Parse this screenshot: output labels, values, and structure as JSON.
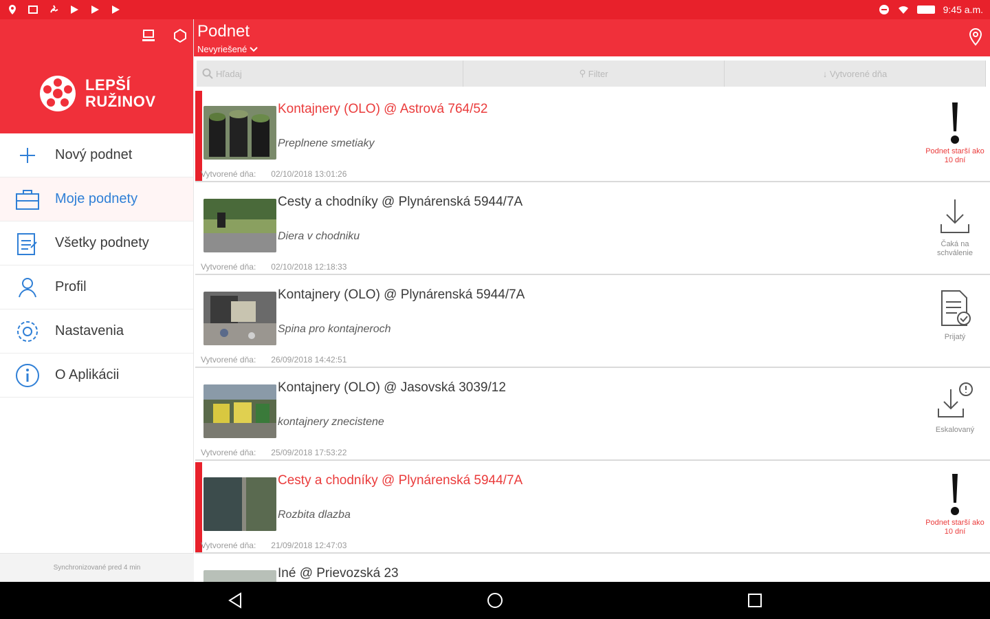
{
  "status_bar": {
    "time": "9:45 a.m."
  },
  "sidebar": {
    "logo_line1": "LEPŠÍ",
    "logo_line2": "RUŽINOV",
    "items": [
      {
        "label": "Nový podnet"
      },
      {
        "label": "Moje podnety"
      },
      {
        "label": "Všetky podnety"
      },
      {
        "label": "Profil"
      },
      {
        "label": "Nastavenia"
      },
      {
        "label": "O Aplikácii"
      }
    ],
    "sync_text": "Synchronizované pred 4 min"
  },
  "header": {
    "title": "Podnet",
    "subtitle": "Nevyriešené"
  },
  "toolbar": {
    "search_placeholder": "Hľadaj",
    "filter_label": "Filter",
    "sort_label": "Vytvorené dňa"
  },
  "items": [
    {
      "title": "Kontajnery (OLO) @ Astrová 764/52",
      "desc": "Preplnene smetiaky",
      "meta_label": "Vytvorené dňa:",
      "date": "02/10/2018 13:01:26",
      "status": "Podnet starší ako 10 dní"
    },
    {
      "title": "Cesty a chodníky @ Plynárenská 5944/7A",
      "desc": "Diera v chodniku",
      "meta_label": "Vytvorené dňa:",
      "date": "02/10/2018 12:18:33",
      "status": "Čaká na schválenie"
    },
    {
      "title": "Kontajnery (OLO) @ Plynárenská 5944/7A",
      "desc": "Spina pro kontajneroch",
      "meta_label": "Vytvorené dňa:",
      "date": "26/09/2018 14:42:51",
      "status": "Prijatý"
    },
    {
      "title": "Kontajnery (OLO) @ Jasovská 3039/12",
      "desc": "kontajnery znecistene",
      "meta_label": "Vytvorené dňa:",
      "date": "25/09/2018 17:53:22",
      "status": "Eskalovaný"
    },
    {
      "title": "Cesty a chodníky @ Plynárenská 5944/7A",
      "desc": "Rozbita dlazba",
      "meta_label": "Vytvorené dňa:",
      "date": "21/09/2018 12:47:03",
      "status": "Podnet starší ako 10 dní"
    },
    {
      "title": "Iné @ Prievozská 23"
    }
  ],
  "colors": {
    "accent": "#f0303a",
    "status_bar": "#e8212b",
    "active_link": "#2f7fd6"
  }
}
